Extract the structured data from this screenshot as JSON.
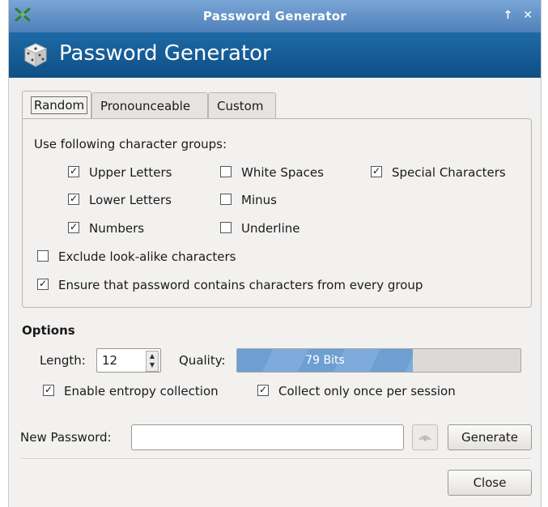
{
  "window": {
    "title": "Password Generator",
    "controls": {
      "shade_glyph": "↑",
      "close_glyph": "✕"
    }
  },
  "banner": {
    "title": "Password Generator",
    "icon": "dice-icon"
  },
  "tabs": [
    {
      "label": "Random",
      "active": true
    },
    {
      "label": "Pronounceable",
      "active": false
    },
    {
      "label": "Custom",
      "active": false
    }
  ],
  "groups": {
    "heading": "Use following character groups:",
    "upper": {
      "label": "Upper Letters",
      "checked": true
    },
    "lower": {
      "label": "Lower Letters",
      "checked": true
    },
    "numbers": {
      "label": "Numbers",
      "checked": true
    },
    "white_spaces": {
      "label": "White Spaces",
      "checked": false
    },
    "minus": {
      "label": "Minus",
      "checked": false
    },
    "underline": {
      "label": "Underline",
      "checked": false
    },
    "special": {
      "label": "Special Characters",
      "checked": true
    },
    "exclude_lookalike": {
      "label": "Exclude look-alike characters",
      "checked": false
    },
    "ensure_every_group": {
      "label": "Ensure that password contains characters from every group",
      "checked": true
    }
  },
  "options": {
    "heading": "Options",
    "length_label": "Length:",
    "length_value": "12",
    "quality_label": "Quality:",
    "quality_text": "79 Bits",
    "quality_fraction": 0.62,
    "entropy": {
      "label": "Enable entropy collection",
      "checked": true
    },
    "collect_once": {
      "label": "Collect only once per session",
      "checked": true
    }
  },
  "new_password": {
    "label": "New Password:",
    "value": ""
  },
  "buttons": {
    "generate": "Generate",
    "close": "Close"
  },
  "colors": {
    "banner": "#155c98",
    "quality_fill": "#76a5d7",
    "window_bg": "#f2f1f0"
  }
}
